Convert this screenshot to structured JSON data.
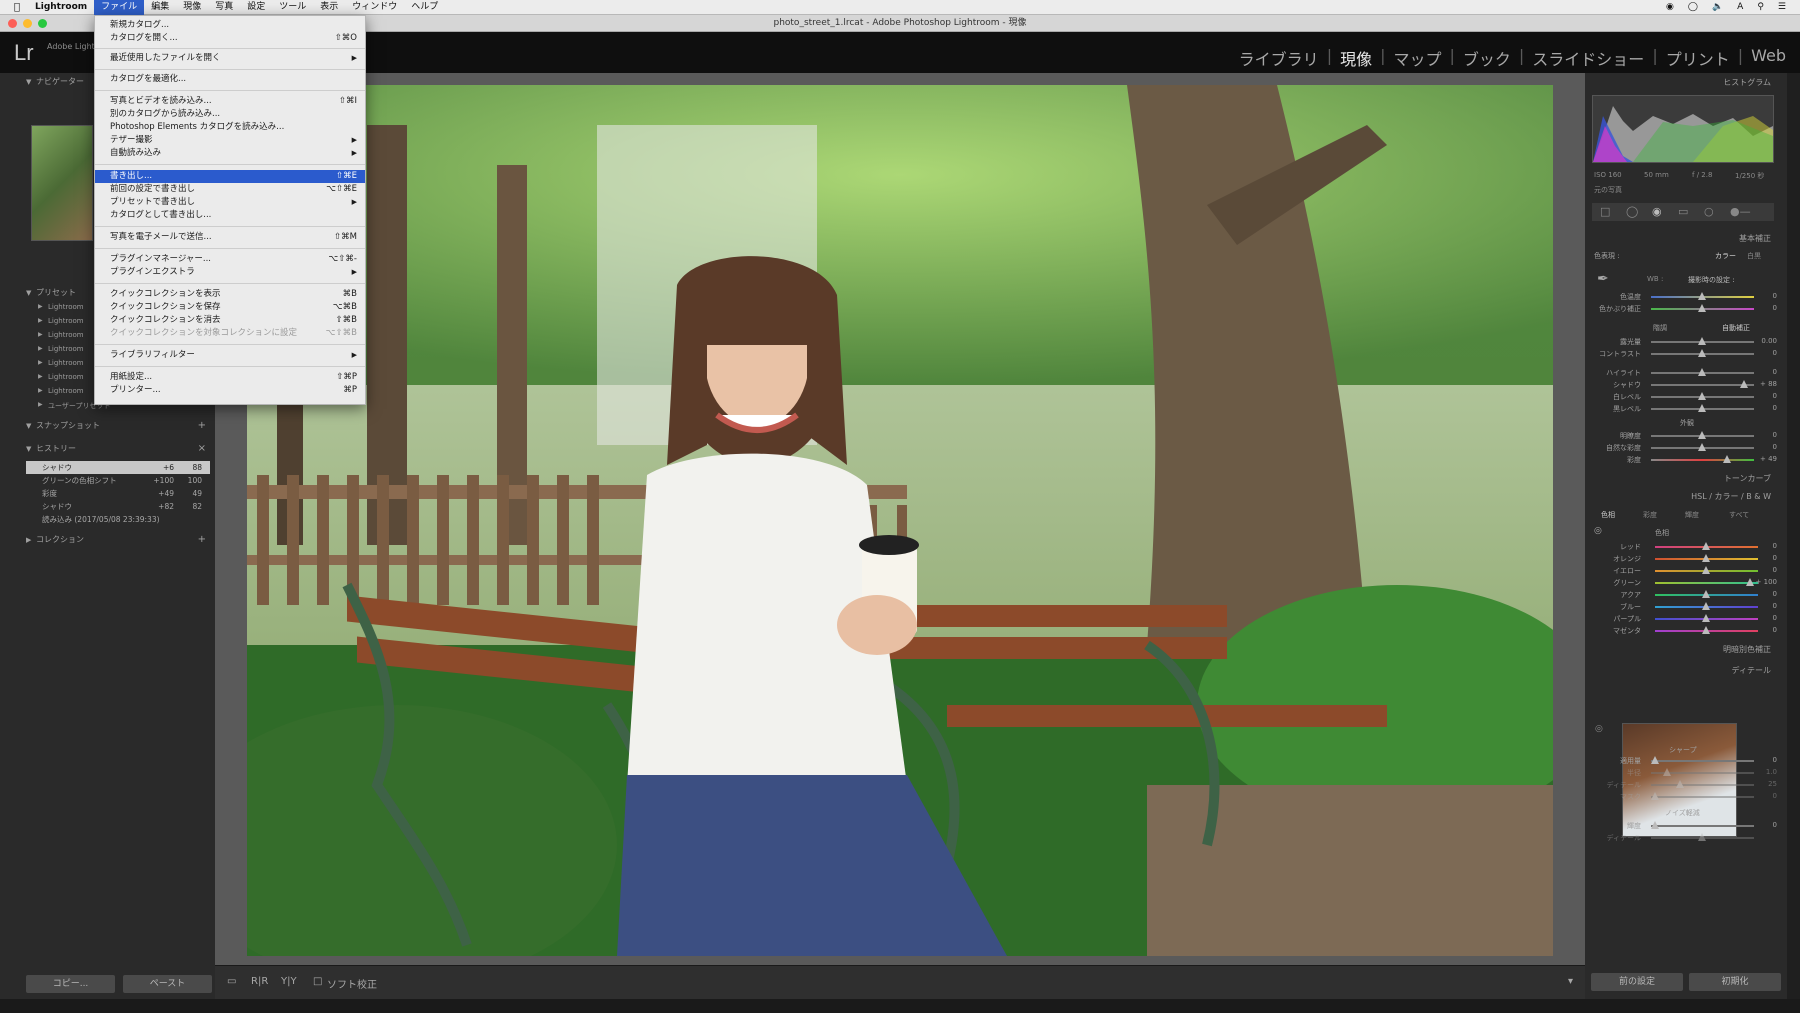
{
  "macbar": {
    "app": "Lightroom",
    "menus": [
      "ファイル",
      "編集",
      "現像",
      "写真",
      "設定",
      "ツール",
      "表示",
      "ウィンドウ",
      "ヘルプ"
    ],
    "active_menu": "ファイル"
  },
  "titlebar": {
    "title": "photo_street_1.lrcat - Adobe Photoshop Lightroom - 現像"
  },
  "header": {
    "logo": "Lr",
    "subtitle": "Adobe Lightroom",
    "modules": [
      "ライブラリ",
      "現像",
      "マップ",
      "ブック",
      "スライドショー",
      "プリント",
      "Web"
    ],
    "active_module": "現像"
  },
  "file_menu": {
    "groups": [
      [
        {
          "label": "新規カタログ...",
          "shortcut": ""
        },
        {
          "label": "カタログを開く...",
          "shortcut": "⇧⌘O"
        }
      ],
      [
        {
          "label": "最近使用したファイルを開く",
          "shortcut": "",
          "submenu": true
        }
      ],
      [
        {
          "label": "カタログを最適化...",
          "shortcut": ""
        }
      ],
      [
        {
          "label": "写真とビデオを読み込み...",
          "shortcut": "⇧⌘I"
        },
        {
          "label": "別のカタログから読み込み...",
          "shortcut": ""
        },
        {
          "label": "Photoshop Elements カタログを読み込み...",
          "shortcut": ""
        },
        {
          "label": "テザー撮影",
          "shortcut": "",
          "submenu": true
        },
        {
          "label": "自動読み込み",
          "shortcut": "",
          "submenu": true
        }
      ],
      [
        {
          "label": "書き出し...",
          "shortcut": "⇧⌘E",
          "highlighted": true
        },
        {
          "label": "前回の設定で書き出し",
          "shortcut": "⌥⇧⌘E"
        },
        {
          "label": "プリセットで書き出し",
          "shortcut": "",
          "submenu": true
        },
        {
          "label": "カタログとして書き出し...",
          "shortcut": ""
        }
      ],
      [
        {
          "label": "写真を電子メールで送信...",
          "shortcut": "⇧⌘M"
        }
      ],
      [
        {
          "label": "プラグインマネージャー...",
          "shortcut": "⌥⇧⌘-"
        },
        {
          "label": "プラグインエクストラ",
          "shortcut": "",
          "submenu": true
        }
      ],
      [
        {
          "label": "クイックコレクションを表示",
          "shortcut": "⌘B"
        },
        {
          "label": "クイックコレクションを保存",
          "shortcut": "⌥⌘B"
        },
        {
          "label": "クイックコレクションを消去",
          "shortcut": "⇧⌘B"
        },
        {
          "label": "クイックコレクションを対象コレクションに設定",
          "shortcut": "⌥⇧⌘B",
          "disabled": true
        }
      ],
      [
        {
          "label": "ライブラリフィルター",
          "shortcut": "",
          "submenu": true
        }
      ],
      [
        {
          "label": "用紙設定...",
          "shortcut": "⇧⌘P"
        },
        {
          "label": "プリンター...",
          "shortcut": "⌘P"
        }
      ]
    ]
  },
  "left_panel": {
    "navigator": "ナビゲーター",
    "presets": "プリセット",
    "preset_items": [
      "Lightroom",
      "Lightroom",
      "Lightroom",
      "Lightroom",
      "Lightroom",
      "Lightroom",
      "Lightroom",
      "ユーザープリセット"
    ],
    "snapshots": "スナップショット",
    "history": "ヒストリー",
    "history_items": [
      {
        "label": "シャドウ",
        "v1": "+6",
        "v2": "88",
        "selected": true
      },
      {
        "label": "グリーンの色相シフト",
        "v1": "+100",
        "v2": "100"
      },
      {
        "label": "彩度",
        "v1": "+49",
        "v2": "49"
      },
      {
        "label": "シャドウ",
        "v1": "+82",
        "v2": "82"
      },
      {
        "label": "読み込み (2017/05/08 23:39:33)",
        "v1": "",
        "v2": ""
      }
    ],
    "collections": "コレクション",
    "copy_btn": "コピー...",
    "paste_btn": "ペースト"
  },
  "right_panel": {
    "histogram": "ヒストグラム",
    "iso": "ISO 160",
    "focal": "50 mm",
    "aperture": "f / 2.8",
    "shutter": "1/250 秒",
    "original_photo": "元の写真",
    "basic": "基本補正",
    "treatment": "色表現 :",
    "color": "カラー",
    "bw": "白黒",
    "wb": "WB :",
    "wb_value": "撮影時の設定 :",
    "temp": "色温度",
    "tint": "色かぶり補正",
    "tone": "階調",
    "auto": "自動補正",
    "exposure": "露光量",
    "exposure_val": "0.00",
    "contrast": "コントラスト",
    "highlights": "ハイライト",
    "shadows": "シャドウ",
    "shadows_val": "+ 88",
    "whites": "白レベル",
    "blacks": "黒レベル",
    "presence": "外観",
    "clarity": "明瞭度",
    "vibrance": "自然な彩度",
    "saturation": "彩度",
    "saturation_val": "+ 49",
    "tonecurve": "トーンカーブ",
    "hsl": "HSL / カラー / B & W",
    "hsl_tabs": [
      "色相",
      "彩度",
      "輝度",
      "すべて"
    ],
    "hue": "色相",
    "hue_rows": [
      {
        "label": "レッド",
        "val": "0"
      },
      {
        "label": "オレンジ",
        "val": "0"
      },
      {
        "label": "イエロー",
        "val": "0"
      },
      {
        "label": "グリーン",
        "val": "+ 100"
      },
      {
        "label": "アクア",
        "val": "0"
      },
      {
        "label": "ブルー",
        "val": "0"
      },
      {
        "label": "パープル",
        "val": "0"
      },
      {
        "label": "マゼンタ",
        "val": "0"
      }
    ],
    "split": "明暗別色補正",
    "detail": "ディテール",
    "sharpen": "シャープ",
    "sharpen_rows": [
      {
        "label": "適用量",
        "val": "0"
      },
      {
        "label": "半径",
        "val": "1.0"
      },
      {
        "label": "ディテール",
        "val": "25"
      },
      {
        "label": "マスク",
        "val": "0"
      }
    ],
    "noise": "ノイズ軽減",
    "noise_rows": [
      {
        "label": "輝度",
        "val": "0"
      },
      {
        "label": "ディテール",
        "val": ""
      }
    ],
    "prev_btn": "前の設定",
    "reset_btn": "初期化"
  },
  "toolbar": {
    "softproof": "ソフト校正"
  },
  "colors": {
    "menu_highlight": "#2b5bcd",
    "panel_bg": "#2a2a2a",
    "center_bg": "#5a5a5a"
  }
}
